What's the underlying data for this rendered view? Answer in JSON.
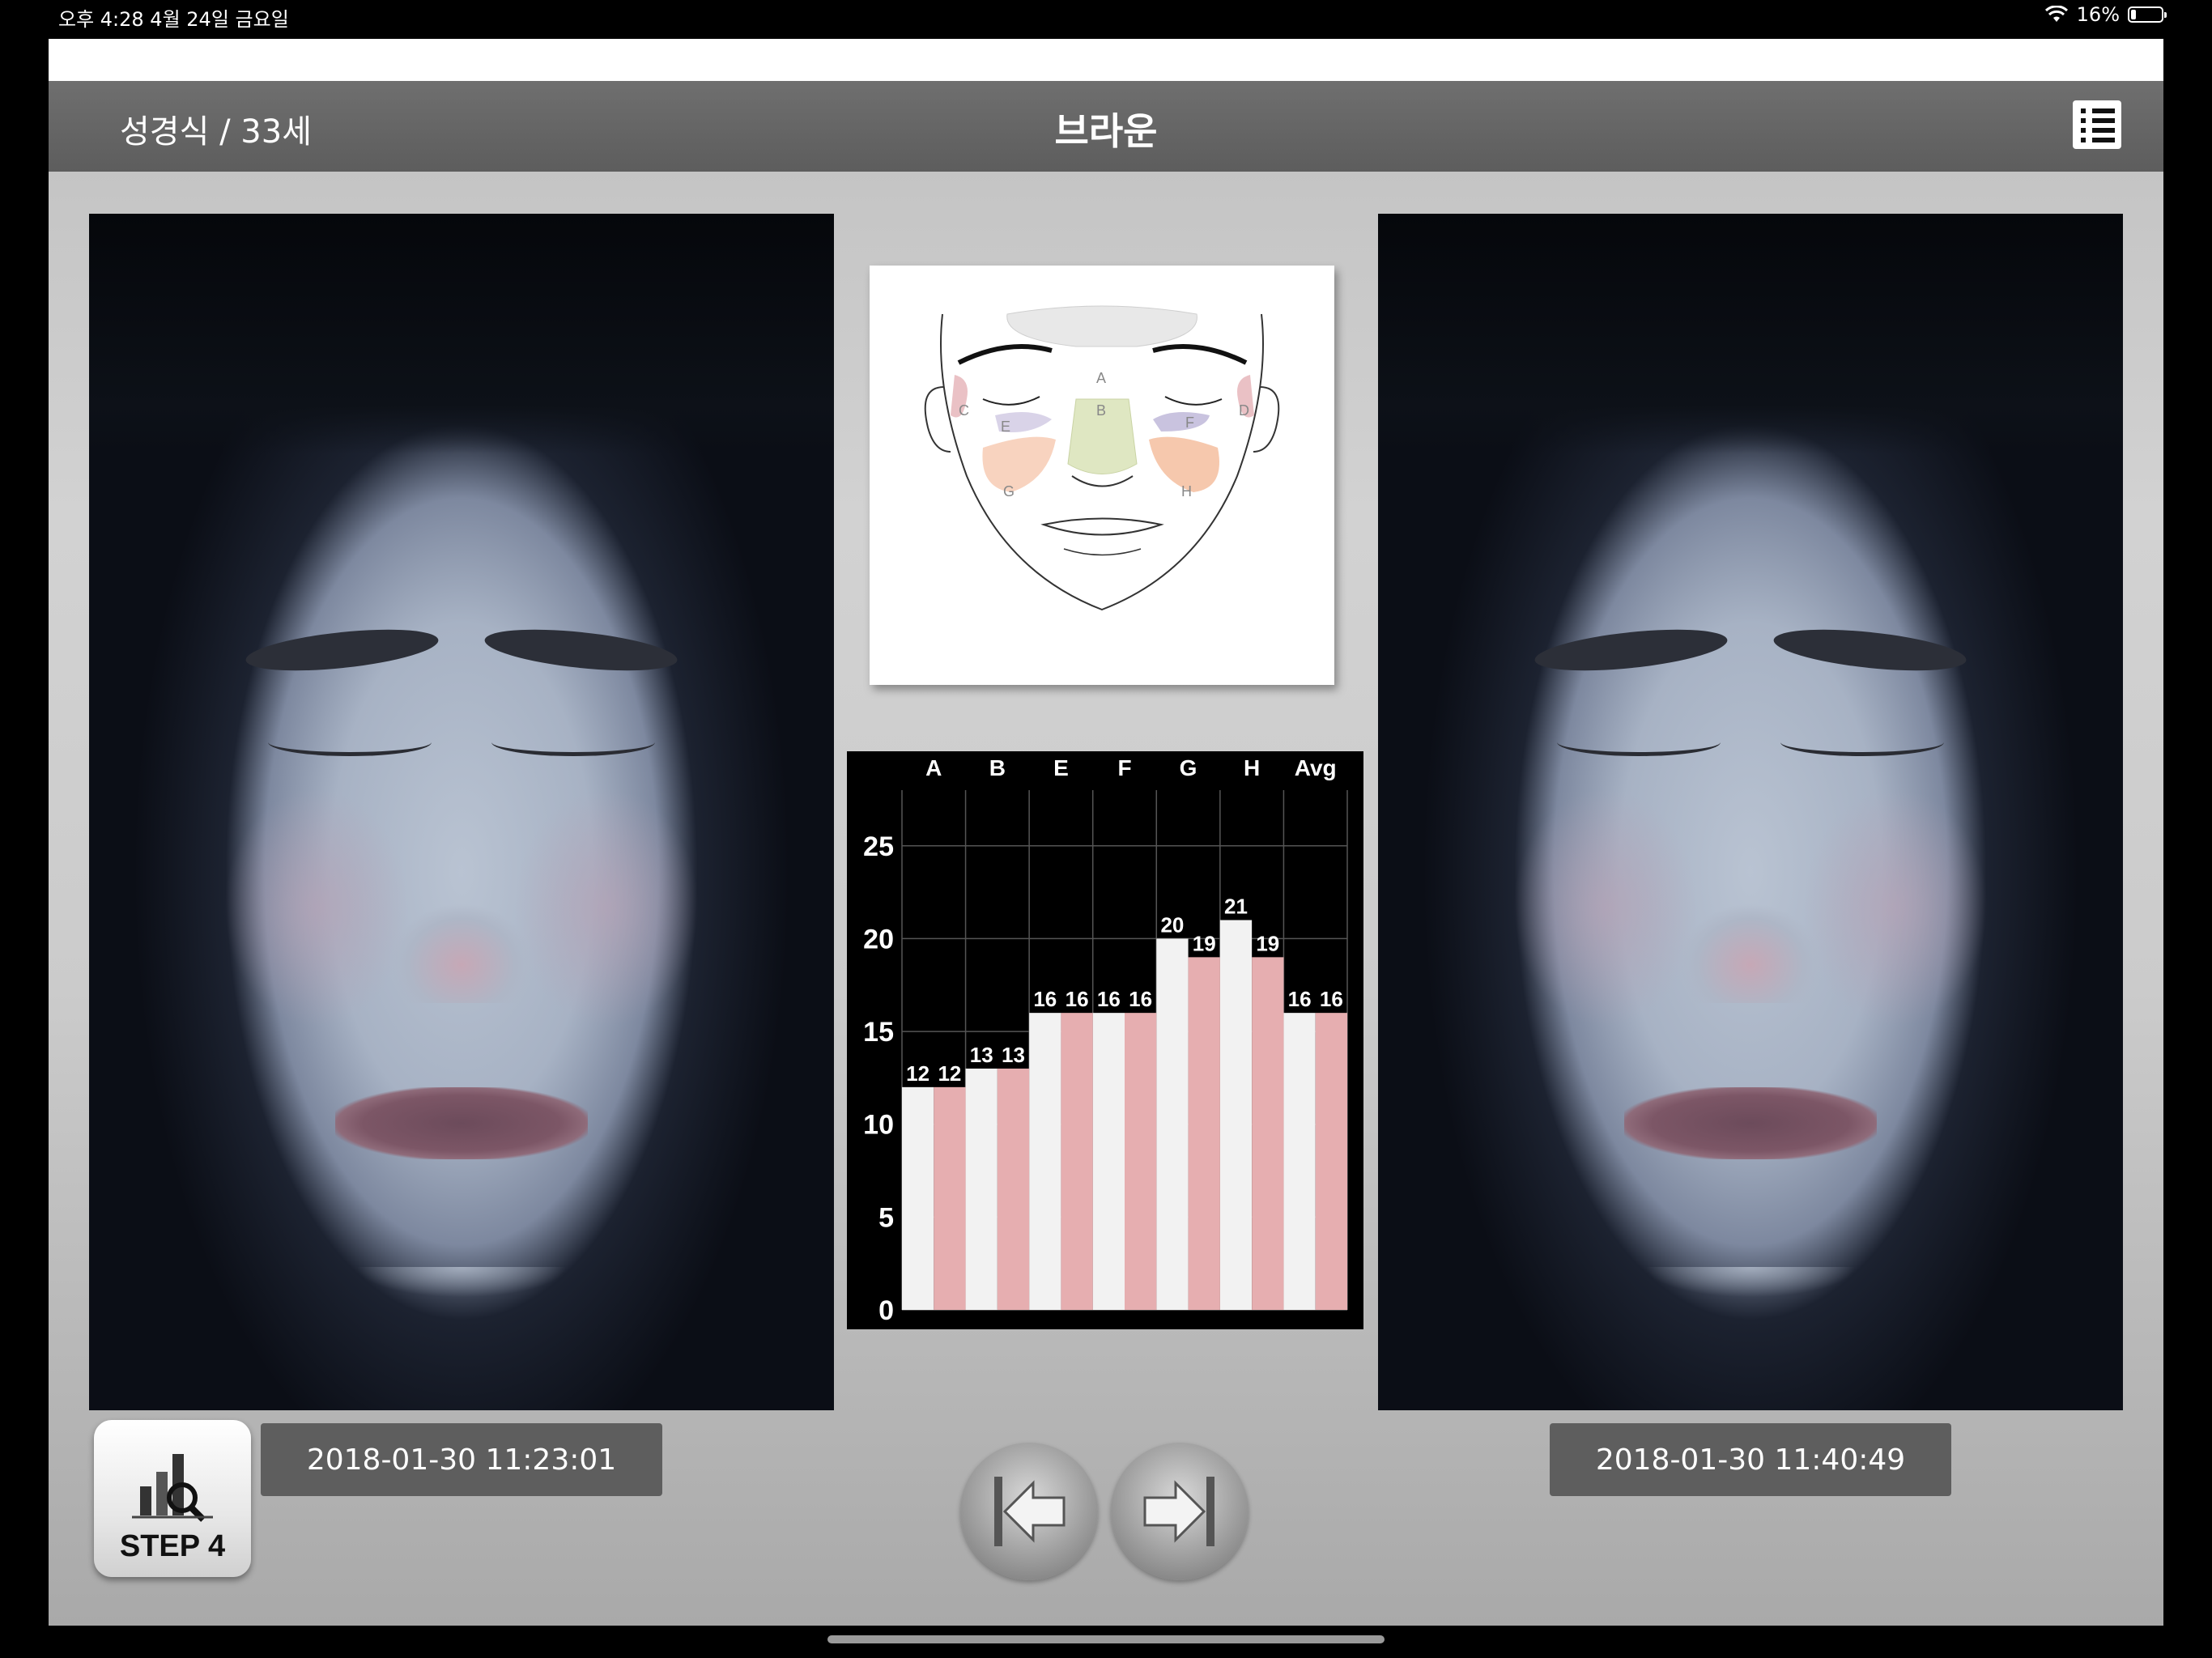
{
  "status_bar": {
    "time_date": "오후 4:28   4월 24일 금요일",
    "battery": "16%",
    "battery_level": 0.16
  },
  "header": {
    "patient": "성경식 / 33세",
    "title": "브라운",
    "menu_icon": "list-icon"
  },
  "face_map": {
    "zone_labels": [
      "A",
      "B",
      "C",
      "D",
      "E",
      "F",
      "G",
      "H"
    ]
  },
  "chart_data": {
    "type": "bar",
    "categories": [
      "A",
      "B",
      "E",
      "F",
      "G",
      "H",
      "Avg"
    ],
    "series": [
      {
        "values": [
          12,
          13,
          16,
          16,
          20,
          21,
          16
        ],
        "color": "#f2f2f2"
      },
      {
        "values": [
          12,
          13,
          16,
          16,
          19,
          19,
          16
        ],
        "color": "#e6aeb0"
      }
    ],
    "yticks": [
      0,
      5,
      10,
      15,
      20,
      25
    ],
    "ylim": [
      0,
      28
    ],
    "grid": true,
    "background": "#000000"
  },
  "photos": {
    "left_timestamp": "2018-01-30 11:23:01",
    "right_timestamp": "2018-01-30 11:40:49"
  },
  "step_button": {
    "label": "STEP 4",
    "icon": "chart-search-icon"
  },
  "navigation": {
    "prev_icon": "skip-back-icon",
    "next_icon": "skip-forward-icon"
  }
}
